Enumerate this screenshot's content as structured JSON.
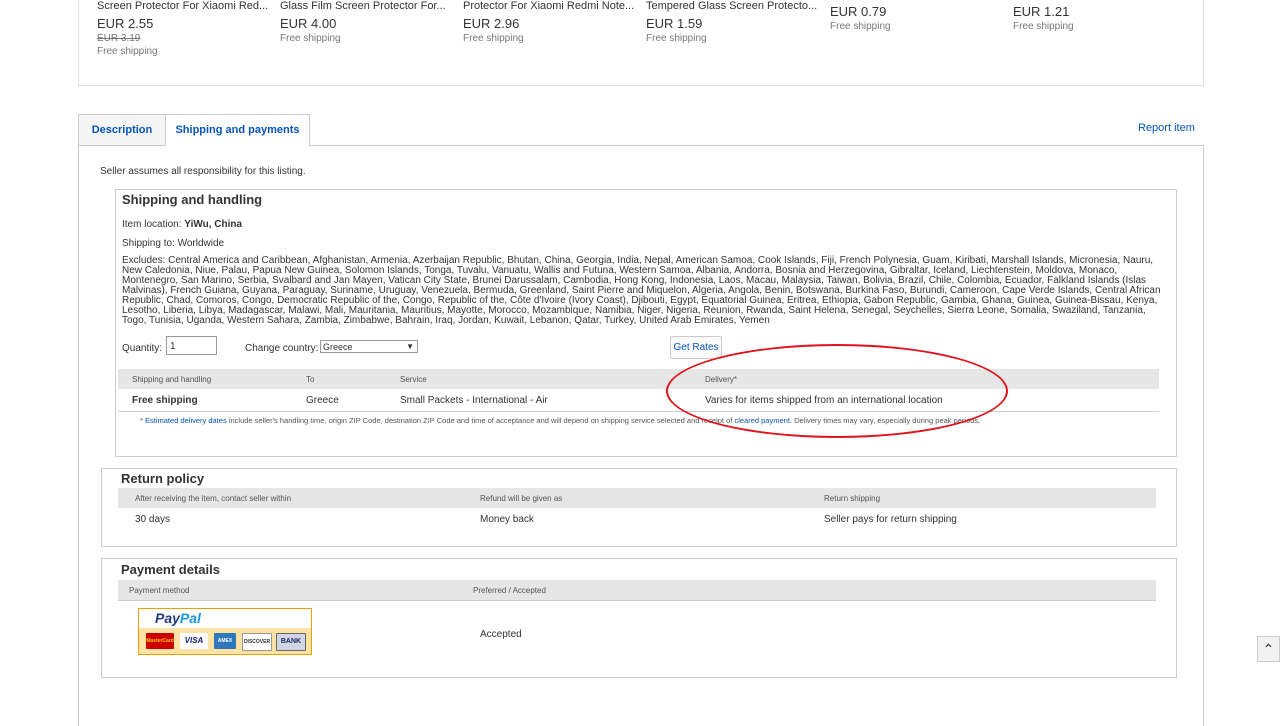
{
  "products": [
    {
      "title": "Screen Protector For Xiaomi Red...",
      "price": "EUR 2.55",
      "old_price": "EUR 3.19",
      "shipping": "Free shipping"
    },
    {
      "title": "Glass Film Screen Protector For...",
      "price": "EUR 4.00",
      "shipping": "Free shipping"
    },
    {
      "title": "Protector For Xiaomi Redmi Note...",
      "price": "EUR 2.96",
      "shipping": "Free shipping"
    },
    {
      "title": "Tempered Glass Screen Protecto...",
      "price": "EUR 1.59",
      "shipping": "Free shipping"
    },
    {
      "price": "EUR 0.79",
      "shipping": "Free shipping"
    },
    {
      "price": "EUR 1.21",
      "shipping": "Free shipping"
    }
  ],
  "tabs": {
    "description": "Description",
    "shipping": "Shipping and payments",
    "report": "Report item"
  },
  "responsibility": "Seller assumes all responsibility for this listing.",
  "shipping": {
    "title": "Shipping and handling",
    "location_label": "Item location:",
    "location_value": "YiWu, China",
    "shipping_to": "Shipping to: Worldwide",
    "excludes": "Excludes: Central America and Caribbean, Afghanistan, Armenia, Azerbaijan Republic, Bhutan, China, Georgia, India, Nepal, American Samoa, Cook Islands, Fiji, French Polynesia, Guam, Kiribati, Marshall Islands, Micronesia, Nauru, New Caledonia, Niue, Palau, Papua New Guinea, Solomon Islands, Tonga, Tuvalu, Vanuatu, Wallis and Futuna, Western Samoa, Albania, Andorra, Bosnia and Herzegovina, Gibraltar, Iceland, Liechtenstein, Moldova, Monaco, Montenegro, San Marino, Serbia, Svalbard and Jan Mayen, Vatican City State, Brunei Darussalam, Cambodia, Hong Kong, Indonesia, Laos, Macau, Malaysia, Taiwan, Bolivia, Brazil, Chile, Colombia, Ecuador, Falkland Islands (Islas Malvinas), French Guiana, Guyana, Paraguay, Suriname, Uruguay, Venezuela, Bermuda, Greenland, Saint Pierre and Miquelon, Algeria, Angola, Benin, Botswana, Burkina Faso, Burundi, Cameroon, Cape Verde Islands, Central African Republic, Chad, Comoros, Congo, Democratic Republic of the, Congo, Republic of the, Côte d'Ivoire (Ivory Coast), Djibouti, Egypt, Equatorial Guinea, Eritrea, Ethiopia, Gabon Republic, Gambia, Ghana, Guinea, Guinea-Bissau, Kenya, Lesotho, Liberia, Libya, Madagascar, Malawi, Mali, Mauritania, Mauritius, Mayotte, Morocco, Mozambique, Namibia, Niger, Nigeria, Reunion, Rwanda, Saint Helena, Senegal, Seychelles, Sierra Leone, Somalia, Swaziland, Tanzania, Togo, Tunisia, Uganda, Western Sahara, Zambia, Zimbabwe, Bahrain, Iraq, Jordan, Kuwait, Lebanon, Qatar, Turkey, United Arab Emirates, Yemen",
    "quantity_label": "Quantity:",
    "quantity_value": "1",
    "country_label": "Change country:",
    "country_value": "Greece",
    "get_rates": "Get Rates",
    "headers": {
      "handling": "Shipping and handling",
      "to": "To",
      "service": "Service",
      "delivery": "Delivery*"
    },
    "row": {
      "handling": "Free shipping",
      "to": "Greece",
      "service": "Small Packets - International - Air",
      "delivery": "Varies for items shipped from an international location"
    },
    "note_star": "* ",
    "note_link1": "Estimated delivery dates",
    "note_text1": " include seller's handling time, origin ZIP Code, destination ZIP Code and time of acceptance and will depend on shipping service selected and receipt of ",
    "note_link2": "cleared payment",
    "note_text2": ". Delivery times may vary, especially during peak periods."
  },
  "returns": {
    "title": "Return policy",
    "headers": {
      "within": "After receiving the item, contact seller within",
      "refund": "Refund will be given as",
      "shipping": "Return shipping"
    },
    "row": {
      "within": "30 days",
      "refund": "Money back",
      "shipping": "Seller pays for return shipping"
    }
  },
  "payment": {
    "title": "Payment details",
    "headers": {
      "method": "Payment method",
      "preferred": "Preferred / Accepted"
    },
    "paypal_a": "Pay",
    "paypal_b": "Pal",
    "cards": {
      "mastercard": "MasterCard",
      "visa": "VISA",
      "amex": "AMEX",
      "discover": "DISCOVER",
      "bank": "BANK"
    },
    "accepted": "Accepted"
  },
  "colors": {
    "link": "#0654ba",
    "annotation": "#e0141c",
    "header_bg": "#e6e6e6"
  }
}
